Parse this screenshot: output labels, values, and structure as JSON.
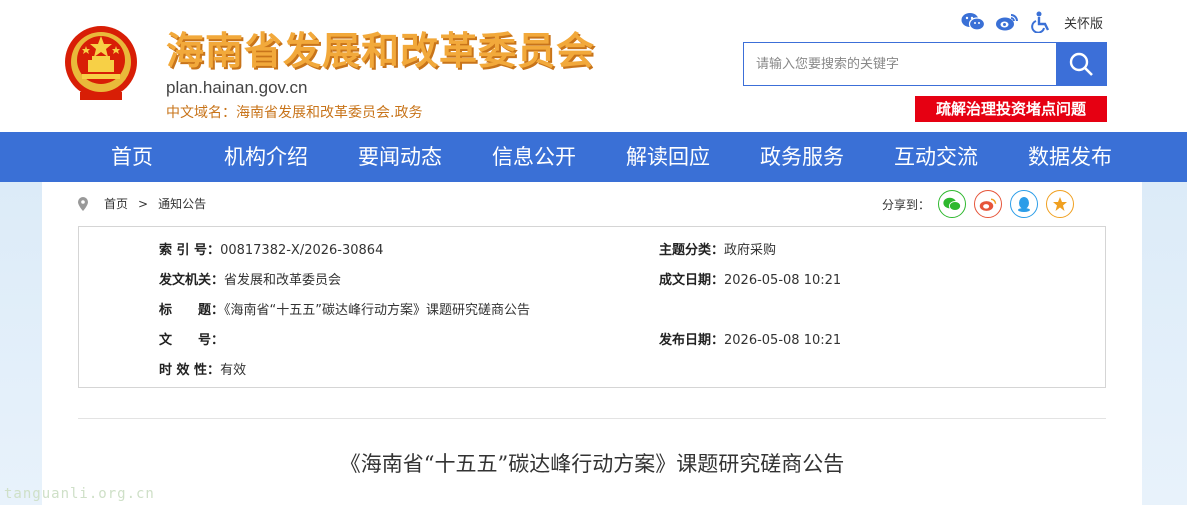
{
  "header": {
    "title": "海南省发展和改革委员会",
    "domain": "plan.hainan.gov.cn",
    "cn_domain": "中文域名：海南省发展和改革委员会.政务",
    "care_mode": "关怀版",
    "search_placeholder": "请输入您要搜索的关键字",
    "banner": "疏解治理投资堵点问题"
  },
  "nav": [
    "首页",
    "机构介绍",
    "要闻动态",
    "信息公开",
    "解读回应",
    "政务服务",
    "互动交流",
    "数据发布"
  ],
  "breadcrumb": {
    "home": "首页",
    "sep": ">",
    "current": "通知公告"
  },
  "share_label": "分享到：",
  "meta": {
    "index_label": "索 引 号：",
    "index_value": "00817382-X/2026-30864",
    "topic_label": "主题分类：",
    "topic_value": "政府采购",
    "issuer_label": "发文机关：",
    "issuer_value": "省发展和改革委员会",
    "date_label": "成文日期：",
    "date_value": "2026-05-08 10:21",
    "title_label": "标　　题：",
    "title_value": "《海南省“十五五”碳达峰行动方案》课题研究磋商公告",
    "docno_label": "文　　号：",
    "docno_value": "",
    "pubdate_label": "发布日期：",
    "pubdate_value": "2026-05-08 10:21",
    "validity_label": "时 效 性：",
    "validity_value": "有效"
  },
  "doc_title": "《海南省“十五五”碳达峰行动方案》课题研究磋商公告",
  "watermark": "tanguanli.org.cn",
  "colors": {
    "nav_bg": "#3a70d6",
    "title_gold": "#f2a93b",
    "banner_red": "#e60012"
  }
}
